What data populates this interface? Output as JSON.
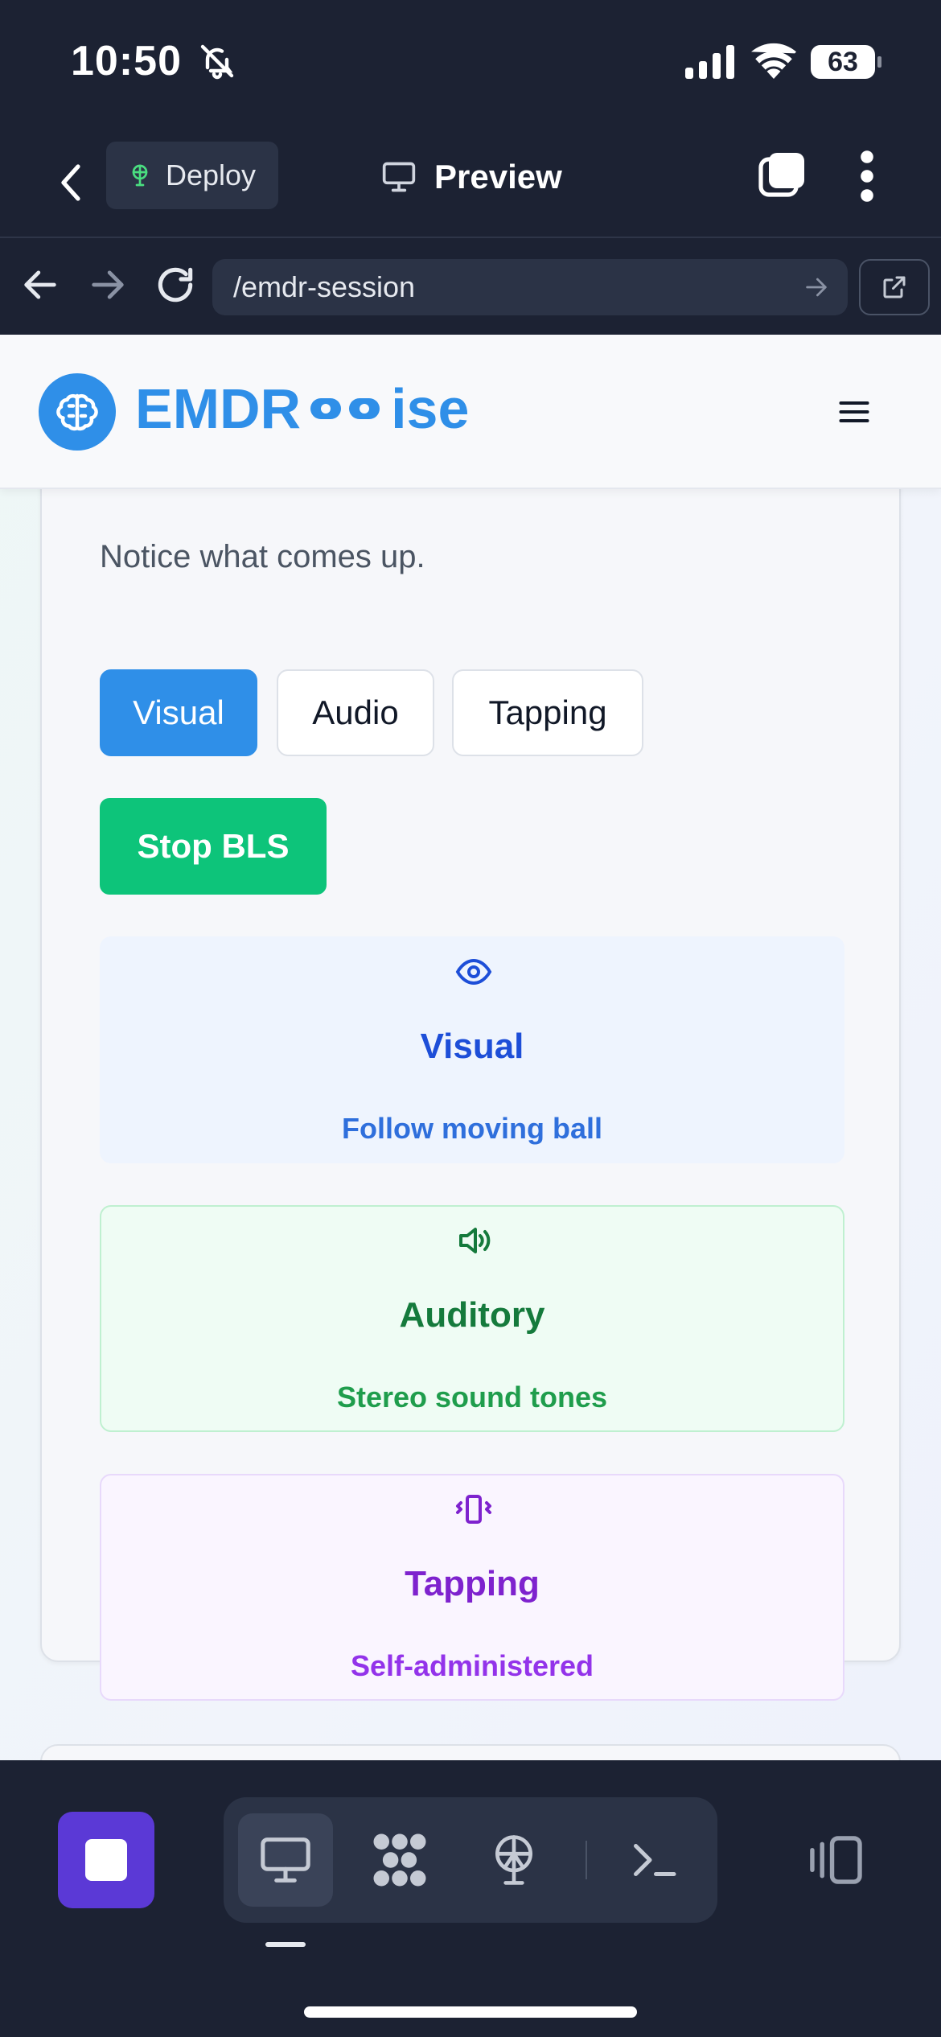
{
  "status_bar": {
    "time": "10:50",
    "battery": "63"
  },
  "app_bar": {
    "deploy_label": "Deploy",
    "preview_label": "Preview"
  },
  "url_bar": {
    "url": "/emdr-session"
  },
  "site": {
    "logo_left": "EMDR",
    "logo_right": "ise"
  },
  "session": {
    "clipped_text": "Notice what comes up.",
    "mode_buttons": [
      "Visual",
      "Audio",
      "Tapping"
    ],
    "selected_mode": "Visual",
    "stop_label": "Stop BLS",
    "modalities": [
      {
        "title": "Visual",
        "subtitle": "Follow moving ball",
        "icon": "eye-icon",
        "color": "#1d4ed8"
      },
      {
        "title": "Auditory",
        "subtitle": "Stereo sound tones",
        "icon": "speaker-icon",
        "color": "#157a3c"
      },
      {
        "title": "Tapping",
        "subtitle": "Self-administered",
        "icon": "vibrate-icon",
        "color": "#7e22ce"
      }
    ]
  },
  "colors": {
    "brand": "#2f8fe8",
    "stop_button": "#0dc47a",
    "toolbar_stop": "#5b39d6"
  }
}
